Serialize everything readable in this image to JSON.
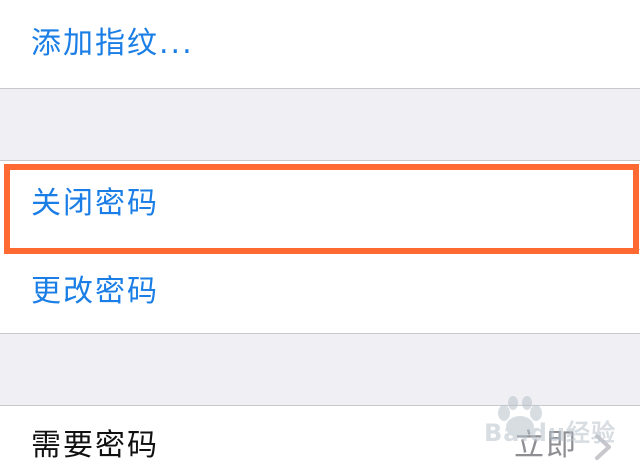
{
  "rows": {
    "add_fingerprint": "添加指纹...",
    "turn_off_passcode": "关闭密码",
    "change_passcode": "更改密码",
    "require_passcode": "需要密码",
    "require_passcode_value": "立即"
  },
  "watermark": {
    "text": "Baidu经验"
  },
  "colors": {
    "link": "#1a7ee6",
    "highlight": "#ff6a33",
    "background": "#efeff4",
    "separator": "#c8c7cc"
  },
  "icons": {
    "disclosure": "chevron-right-icon"
  }
}
